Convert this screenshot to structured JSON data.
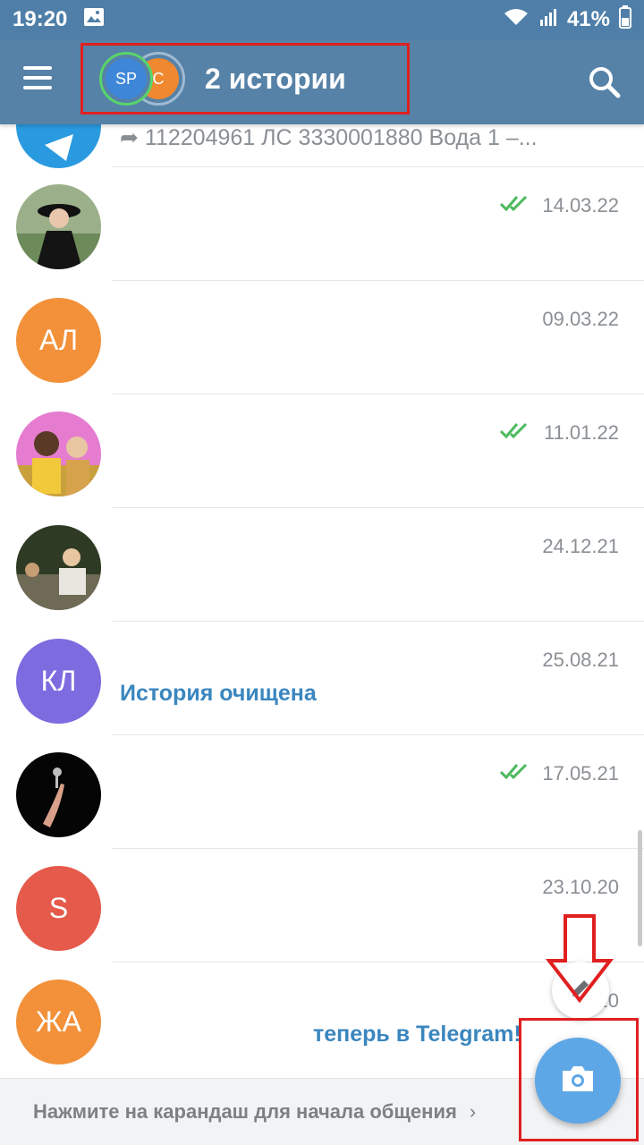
{
  "status_bar": {
    "time": "19:20",
    "battery": "41%",
    "icons": [
      "image-icon",
      "wifi-icon",
      "signal-icon",
      "battery-icon"
    ]
  },
  "app_bar": {
    "stories_title": "2 истории",
    "story_avatars": [
      "SP",
      "C"
    ],
    "icons": [
      "menu-icon",
      "search-icon"
    ]
  },
  "chats": [
    {
      "avatar_type": "icon",
      "color": "#2a9ae0",
      "message": "112204961 ЛС 3330001880 Вода 1 –...",
      "forwarded": true
    },
    {
      "avatar_type": "photo",
      "date": "14.03.22",
      "read": true
    },
    {
      "avatar_type": "initials",
      "initials": "АЛ",
      "color": "#f2913a",
      "date": "09.03.22",
      "read": false
    },
    {
      "avatar_type": "photo",
      "date": "11.01.22",
      "read": true
    },
    {
      "avatar_type": "photo",
      "date": "24.12.21",
      "read": false
    },
    {
      "avatar_type": "initials",
      "initials": "КЛ",
      "color": "#7d6be0",
      "date": "25.08.21",
      "message": "История очищена",
      "read": false
    },
    {
      "avatar_type": "photo",
      "date": "17.05.21",
      "read": true
    },
    {
      "avatar_type": "initials",
      "initials": "S",
      "color": "#e55a4a",
      "date": "23.10.20",
      "read": false
    },
    {
      "avatar_type": "initials",
      "initials": "ЖА",
      "color": "#f2913a",
      "date": "2...20",
      "message": "теперь в Telegram!",
      "read": false
    }
  ],
  "hint_bar": {
    "text": "Нажмите на карандаш для начала общения",
    "arrow": "›"
  },
  "colors": {
    "header": "#5682a7",
    "status_bar": "#4f7fa8",
    "accent_text": "#3a86bf",
    "checks": "#4cba5c",
    "annotation": "#e02020",
    "fab": "#5ea7e6"
  }
}
